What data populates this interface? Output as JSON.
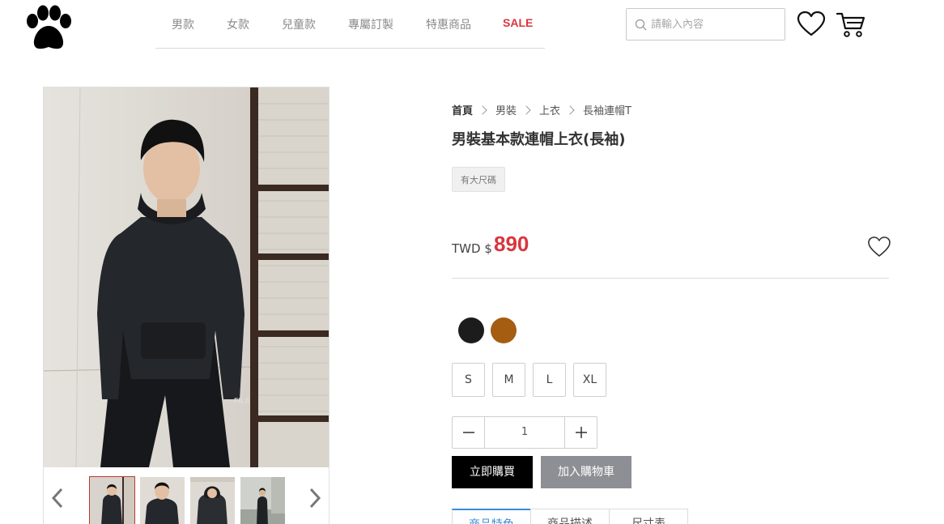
{
  "header": {
    "nav": [
      {
        "label": "男款",
        "color": "#8a8a8a"
      },
      {
        "label": "女款",
        "color": "#8a8a8a"
      },
      {
        "label": "兒童款",
        "color": "#8a8a8a"
      },
      {
        "label": "專屬訂製",
        "color": "#8a8a8a"
      },
      {
        "label": "特惠商品",
        "color": "#8a8a8a"
      },
      {
        "label": "SALE",
        "color": "#d9363e"
      }
    ],
    "search_placeholder": "請輸入內容",
    "icons": [
      "paw-logo-icon",
      "search-icon",
      "heart-icon",
      "cart-icon"
    ]
  },
  "breadcrumb": [
    "首頁",
    "男裝",
    "上衣",
    "長袖連帽T"
  ],
  "product": {
    "title": "男裝基本款連帽上衣(長袖)",
    "tag": "有大尺碼",
    "price_label": "TWD $",
    "price": "890",
    "price_color": "#d9363e",
    "colors": [
      {
        "name": "black",
        "hex": "#1c1c1c"
      },
      {
        "name": "brown",
        "hex": "#a55d12"
      }
    ],
    "sizes": [
      "S",
      "M",
      "L",
      "XL"
    ],
    "quantity": "1",
    "buy_now": "立即購買",
    "add_to_cart": "加入購物車"
  },
  "gallery": {
    "thumbnails": 4,
    "active_thumbnail": 1
  },
  "tabs": [
    "商品特色",
    "商品描述",
    "尺寸表"
  ]
}
